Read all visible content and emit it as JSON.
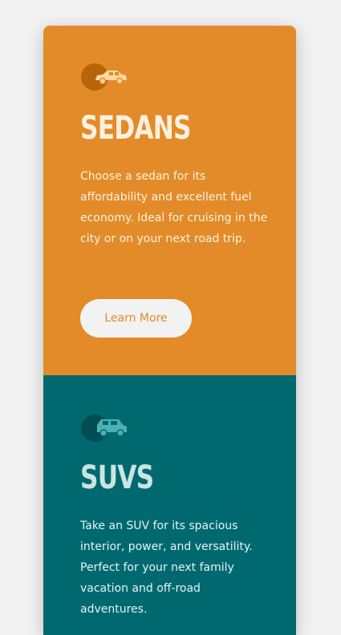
{
  "colors": {
    "background": "#f2f2f2",
    "sedans_panel": "#e38b29",
    "suvs_panel": "#006970",
    "button_bg": "#f2f2f2",
    "button_text": "#e38b29"
  },
  "panels": [
    {
      "icon": "sedan-car-icon",
      "title": "SEDANS",
      "text": "Choose a sedan for its affordability and excellent fuel economy. Ideal for cruising in the city or on your next road trip.",
      "button_label": "Learn More"
    },
    {
      "icon": "suv-car-icon",
      "title": "SUVS",
      "text": "Take an SUV for its spacious interior, power, and versatility. Perfect for your next family vacation and off-road adventures."
    }
  ]
}
